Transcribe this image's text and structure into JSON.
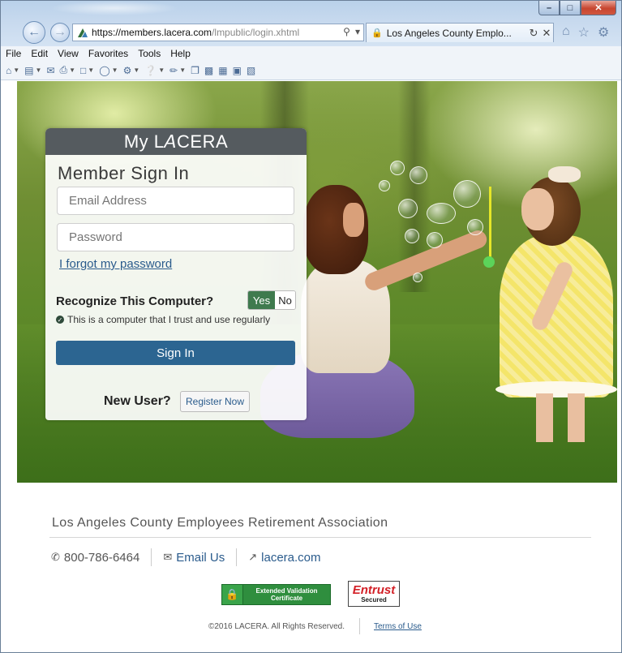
{
  "browser": {
    "url_scheme_host": "https://members.lacera.com",
    "url_path": "/lmpublic/login.xhtml",
    "tab_title": "Los Angeles County Emplo...",
    "menu": [
      "File",
      "Edit",
      "View",
      "Favorites",
      "Tools",
      "Help"
    ],
    "window_buttons": [
      "minimize",
      "maximize",
      "close"
    ]
  },
  "login": {
    "brand": "My L𝘈CERA",
    "heading": "Member Sign In",
    "email_placeholder": "Email Address",
    "password_placeholder": "Password",
    "forgot_link": "I forgot my password",
    "recognize_label": "Recognize This Computer?",
    "yes_label": "Yes",
    "no_label": "No",
    "trust_note": "This is a computer that I trust and use regularly",
    "signin_label": "Sign In",
    "new_user_label": "New User?",
    "register_label": "Register Now"
  },
  "footer": {
    "org_name": "Los Angeles County Employees Retirement Association",
    "phone": "800-786-6464",
    "email_label": "Email Us",
    "site_label": "lacera.com",
    "ev_badge_line1": "Extended Validation",
    "ev_badge_line2": "Certificate",
    "entrust_line1": "Entrust",
    "entrust_line2": "Secured",
    "copyright": "©2016 LACERA. All Rights Reserved.",
    "terms_label": "Terms of Use"
  },
  "colors": {
    "signin_button": "#2c6591",
    "yes_toggle": "#3f7a4e",
    "card_header": "#555b5f",
    "link": "#2a5b8c"
  }
}
